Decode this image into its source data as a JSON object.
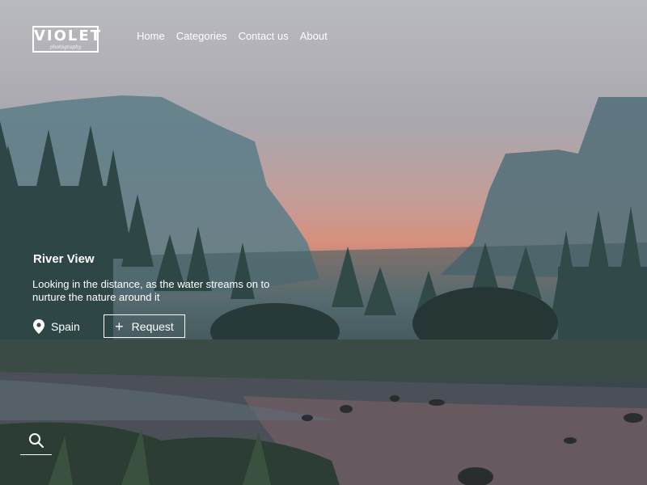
{
  "brand": {
    "name": "VIOLET",
    "tagline": "photography"
  },
  "nav": {
    "items": [
      "Home",
      "Categories",
      "Contact us",
      "About"
    ]
  },
  "hero": {
    "title": "River View",
    "description": "Looking in the distance, as the water streams on to nurture the nature around it",
    "location": "Spain",
    "request_label": "Request"
  },
  "icons": {
    "location": "location-pin-icon",
    "plus": "plus-icon",
    "search": "search-icon"
  },
  "colors": {
    "text": "#ffffff",
    "sky": "#b9babf",
    "sunset": "#d88f7d",
    "forest": "#2a3434"
  }
}
